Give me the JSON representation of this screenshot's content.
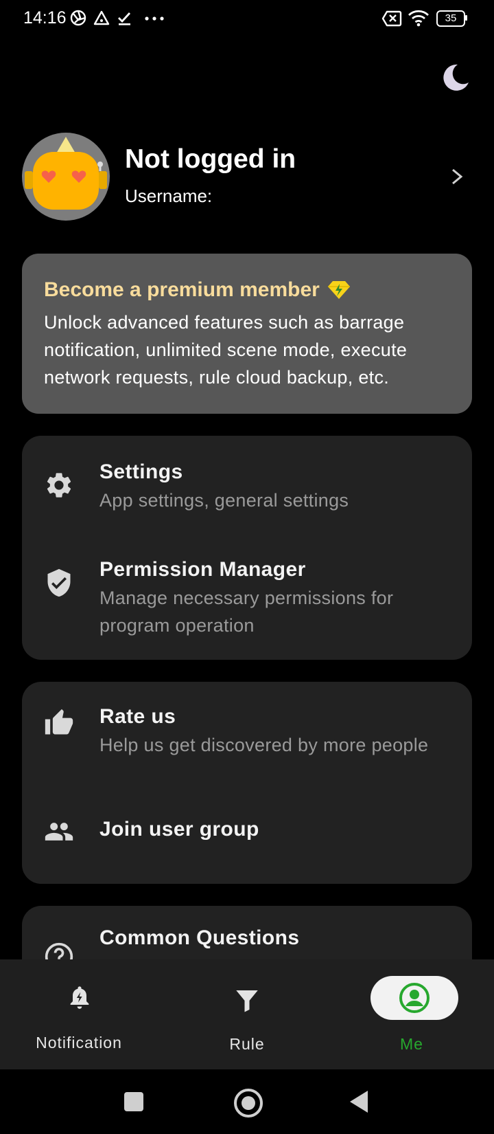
{
  "status_bar": {
    "time": "14:16",
    "battery": "35"
  },
  "profile": {
    "name": "Not logged in",
    "username_label": "Username:"
  },
  "premium": {
    "title": "Become a premium member",
    "description": "Unlock advanced features such as barrage notification, unlimited scene mode, execute network requests, rule cloud backup, etc."
  },
  "menu_groups": [
    {
      "items": [
        {
          "icon": "gear-icon",
          "title": "Settings",
          "subtitle": "App settings, general settings"
        },
        {
          "icon": "shield-check-icon",
          "title": "Permission Manager",
          "subtitle": "Manage necessary permissions for program operation"
        }
      ]
    },
    {
      "items": [
        {
          "icon": "thumb-up-icon",
          "title": "Rate us",
          "subtitle": "Help us get discovered by more people"
        },
        {
          "icon": "group-icon",
          "title": "Join user group",
          "subtitle": ""
        }
      ]
    },
    {
      "items": [
        {
          "icon": "help-circle-icon",
          "title": "Common Questions",
          "subtitle": ""
        }
      ]
    }
  ],
  "bottom_nav": {
    "items": [
      {
        "icon": "bell-bolt-icon",
        "label": "Notification",
        "active": false
      },
      {
        "icon": "filter-icon",
        "label": "Rule",
        "active": false
      },
      {
        "icon": "account-circle-icon",
        "label": "Me",
        "active": true
      }
    ],
    "active_color": "#27a82e"
  },
  "colors": {
    "background": "#000000",
    "card": "#222222",
    "premium_card": "#575757",
    "premium_title": "#f8dc9c",
    "subtitle": "#9a9a9a"
  }
}
